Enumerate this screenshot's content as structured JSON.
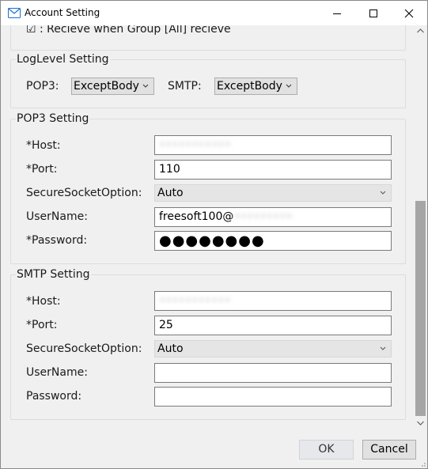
{
  "window": {
    "title": "Account Setting"
  },
  "top": {
    "checkbox_label": "☑ : Recieve when Group [All] recieve"
  },
  "loglevel": {
    "title": "LogLevel Setting",
    "pop3_label": "POP3:",
    "pop3_value": "ExceptBody",
    "smtp_label": "SMTP:",
    "smtp_value": "ExceptBody"
  },
  "pop3": {
    "title": "POP3 Setting",
    "host_label": "*Host:",
    "host_value": "•••••••••••",
    "port_label": "*Port:",
    "port_value": "110",
    "secure_label": "SecureSocketOption:",
    "secure_value": "Auto",
    "username_label": "UserName:",
    "username_value": "freesoft100@",
    "username_domain": "•••••••••",
    "password_label": "*Password:",
    "password_value": "●●●●●●●●"
  },
  "smtp": {
    "title": "SMTP Setting",
    "host_label": "*Host:",
    "host_value": "•••••••••••",
    "port_label": "*Port:",
    "port_value": "25",
    "secure_label": "SecureSocketOption:",
    "secure_value": "Auto",
    "username_label": "UserName:",
    "username_value": "",
    "password_label": "Password:",
    "password_value": ""
  },
  "buttons": {
    "ok": "OK",
    "cancel": "Cancel"
  },
  "colors": {
    "accent": "#1a6fd1",
    "scroll_thumb": "#a6a6a6"
  }
}
